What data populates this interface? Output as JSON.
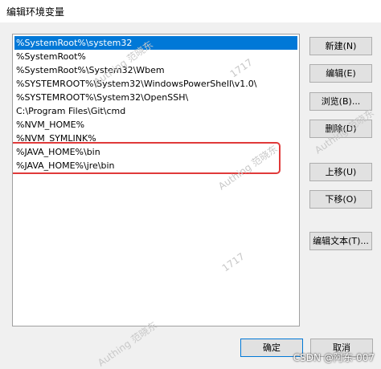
{
  "window": {
    "title": "编辑环境变量"
  },
  "list": {
    "items": [
      "%SystemRoot%\\system32",
      "%SystemRoot%",
      "%SystemRoot%\\System32\\Wbem",
      "%SYSTEMROOT%\\System32\\WindowsPowerShell\\v1.0\\",
      "%SYSTEMROOT%\\System32\\OpenSSH\\",
      "C:\\Program Files\\Git\\cmd",
      "%NVM_HOME%",
      "%NVM_SYMLINK%",
      "%JAVA_HOME%\\bin",
      "%JAVA_HOME%\\jre\\bin"
    ],
    "selected_index": 0
  },
  "buttons": {
    "new": "新建(N)",
    "edit": "编辑(E)",
    "browse": "浏览(B)...",
    "delete": "删除(D)",
    "move_up": "上移(U)",
    "move_down": "下移(O)",
    "edit_text": "编辑文本(T)...",
    "ok": "确定",
    "cancel": "取消"
  },
  "watermark": {
    "line1": "Authing 范晓东",
    "line2": "1717"
  },
  "footer": {
    "credit": "CSDN @阿东-007"
  },
  "colors": {
    "selection": "#0078d7",
    "highlight": "#e03a3a"
  }
}
